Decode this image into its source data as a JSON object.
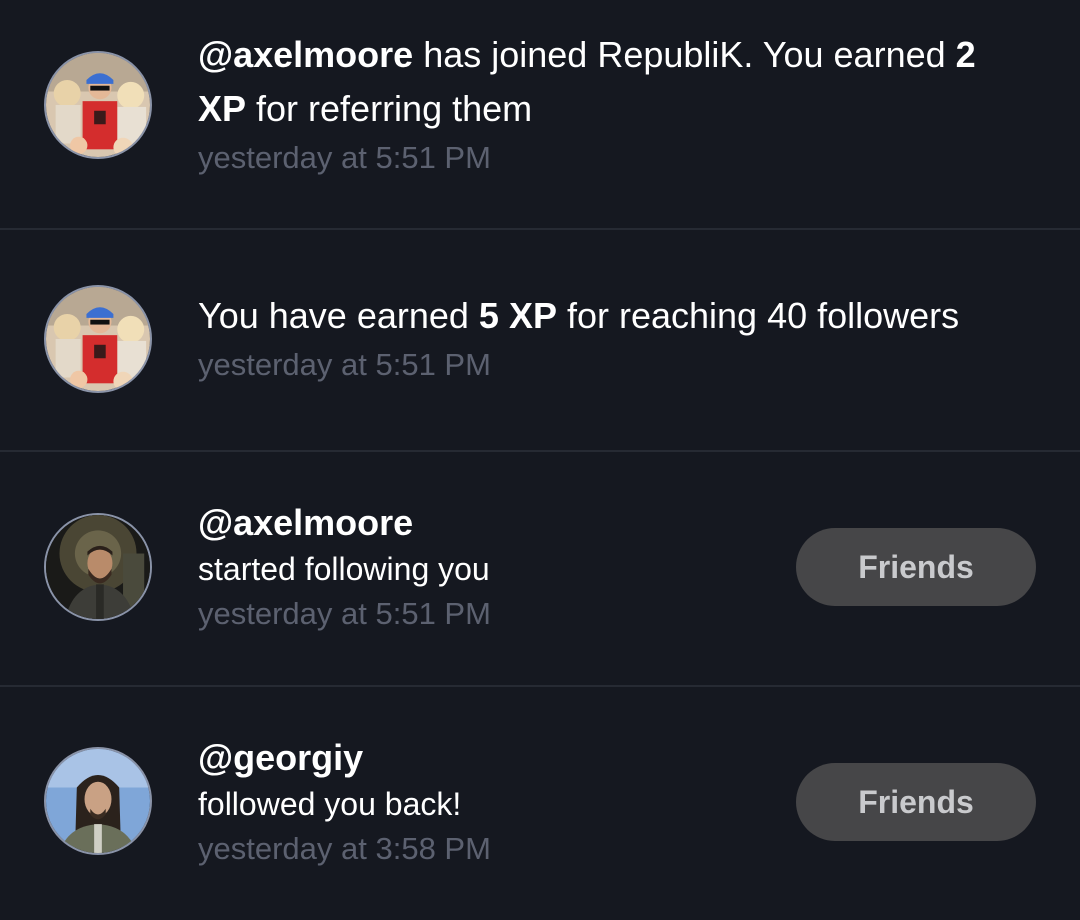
{
  "notifications": [
    {
      "avatar": "group-photo-avatar",
      "handle": "@axelmoore",
      "text_1": " has joined RepubliK. You earned ",
      "xp": "2 XP",
      "text_2": " for referring them",
      "time": "yesterday at 5:51 PM"
    },
    {
      "avatar": "group-photo-avatar",
      "text_1": "You have earned ",
      "xp": "5 XP",
      "text_2": " for reaching 40 followers",
      "time": "yesterday at 5:51 PM"
    },
    {
      "avatar": "bearded-man-avatar",
      "handle": "@axelmoore",
      "text": "started following you",
      "time": "yesterday at 5:51 PM",
      "button_label": "Friends"
    },
    {
      "avatar": "long-hair-man-avatar",
      "handle": "@georgiy",
      "text": "followed you back!",
      "time": "yesterday at 3:58 PM",
      "button_label": "Friends"
    }
  ],
  "colors": {
    "background": "#151820",
    "divider": "#262a33",
    "timestamp": "#5c6170",
    "button_bg": "#464648",
    "button_text": "#c9cacd"
  }
}
